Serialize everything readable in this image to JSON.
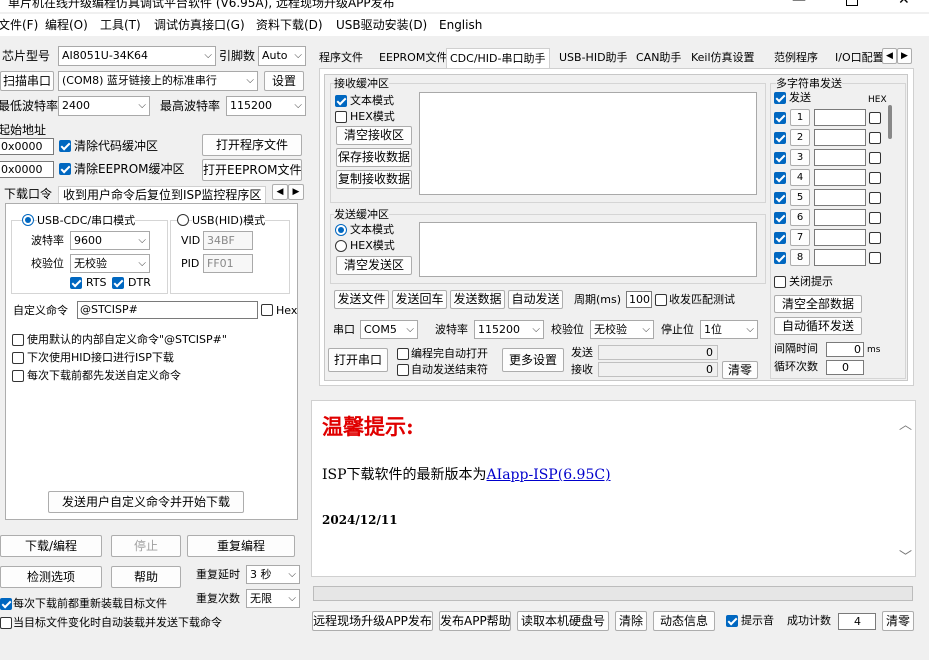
{
  "window": {
    "title": "单片机在线升级编程仿真调试平台软件 (V6.95A), 远程现场升级APP发布"
  },
  "menu": [
    "文件(F)",
    "编程(O)",
    "工具(T)",
    "调试仿真接口(G)",
    "资料下载(D)",
    "USB驱动安装(D)",
    "English"
  ],
  "left": {
    "chip_label": "芯片型号",
    "chip_value": "AI8051U-34K64",
    "pin_label": "引脚数",
    "pin_value": "Auto",
    "scan_btn": "扫描串口",
    "port_value": "(COM8) 蓝牙链接上的标准串行",
    "settings_btn": "设置",
    "min_baud_label": "最低波特率",
    "min_baud_value": "2400",
    "max_baud_label": "最高波特率",
    "max_baud_value": "115200",
    "start_addr_label": "起始地址",
    "addr1": "0x0000",
    "clear_code_label": "清除代码缓冲区",
    "open_prog_btn": "打开程序文件",
    "addr2": "0x0000",
    "clear_eeprom_label": "清除EEPROM缓冲区",
    "open_eeprom_btn": "打开EEPROM文件",
    "sub_tab1": "下载口令",
    "sub_tab2": "收到用户命令后复位到ISP监控程序区",
    "usb_cdc_label": "USB-CDC/串口模式",
    "usb_hid_label": "USB(HID)模式",
    "baud_label": "波特率",
    "baud_value": "9600",
    "parity_label": "校验位",
    "parity_value": "无校验",
    "vid_label": "VID",
    "vid_value": "34BF",
    "pid_label": "PID",
    "pid_value": "FF01",
    "rts_label": "RTS",
    "dtr_label": "DTR",
    "custom_cmd_label": "自定义命令",
    "custom_cmd_value": "@STCISP#",
    "hex_label": "Hex",
    "opt1": "使用默认的内部自定义命令\"@STCISP#\"",
    "opt2": "下次使用HID接口进行ISP下载",
    "opt3": "每次下载前都先发送自定义命令",
    "send_cmd_btn": "发送用户自定义命令并开始下载",
    "download_btn": "下载/编程",
    "stop_btn": "停止",
    "reprog_btn": "重复编程",
    "check_btn": "检测选项",
    "help_btn": "帮助",
    "delay_label": "重复延时",
    "delay_value": "3 秒",
    "count_label": "重复次数",
    "count_value": "无限",
    "reload_label": "每次下载前都重新装载目标文件",
    "auto_label": "当目标文件变化时自动装载并发送下载命令"
  },
  "tabs": [
    "程序文件",
    "EEPROM文件",
    "CDC/HID-串口助手",
    "USB-HID助手",
    "CAN助手",
    "Keil仿真设置",
    "范例程序",
    "I/O口配置"
  ],
  "serial": {
    "recv_title": "接收缓冲区",
    "text_mode": "文本模式",
    "hex_mode": "HEX模式",
    "clear_recv": "清空接收区",
    "save_recv": "保存接收数据",
    "copy_recv": "复制接收数据",
    "send_title": "发送缓冲区",
    "clear_send": "清空发送区",
    "send_file": "发送文件",
    "send_enter": "发送回车",
    "send_data": "发送数据",
    "auto_send": "自动发送",
    "period_label": "周期(ms)",
    "period_value": "100",
    "match_label": "收发匹配测试",
    "port_label": "串口",
    "port_value": "COM5",
    "baud_label": "波特率",
    "baud_value": "115200",
    "parity_label": "校验位",
    "parity_value": "无校验",
    "stop_label": "停止位",
    "stop_value": "1位",
    "open_btn": "打开串口",
    "auto_open_label": "编程完自动打开",
    "auto_end_label": "自动发送结束符",
    "more_btn": "更多设置",
    "tx_label": "发送",
    "tx_value": "0",
    "rx_label": "接收",
    "rx_value": "0",
    "clear_btn": "清零"
  },
  "multi": {
    "title": "多字符串发送",
    "send_label": "发送",
    "hex_label": "HEX",
    "rows": [
      "1",
      "2",
      "3",
      "4",
      "5",
      "6",
      "7",
      "8"
    ],
    "close_tip": "关闭提示",
    "clear_all": "清空全部数据",
    "loop_send": "自动循环发送",
    "interval_label": "间隔时间",
    "interval_value": "0",
    "interval_unit": "ms",
    "loop_label": "循环次数",
    "loop_value": "0"
  },
  "tips": {
    "title": "温馨提示:",
    "line_prefix": "ISP下载软件的最新版本为",
    "link": "AIapp-ISP(6.95C)",
    "date": "2024/12/11"
  },
  "bottom": {
    "remote_btn": "远程现场升级APP发布",
    "help_btn": "发布APP帮助",
    "disk_btn": "读取本机硬盘号",
    "clear_btn": "清除",
    "dynamic_btn": "动态信息",
    "beep_label": "提示音",
    "success_label": "成功计数",
    "success_value": "4",
    "reset_btn": "清零"
  },
  "colors": {
    "accent": "#0067c0",
    "tip_red": "#e00000",
    "link": "#0000cc"
  }
}
